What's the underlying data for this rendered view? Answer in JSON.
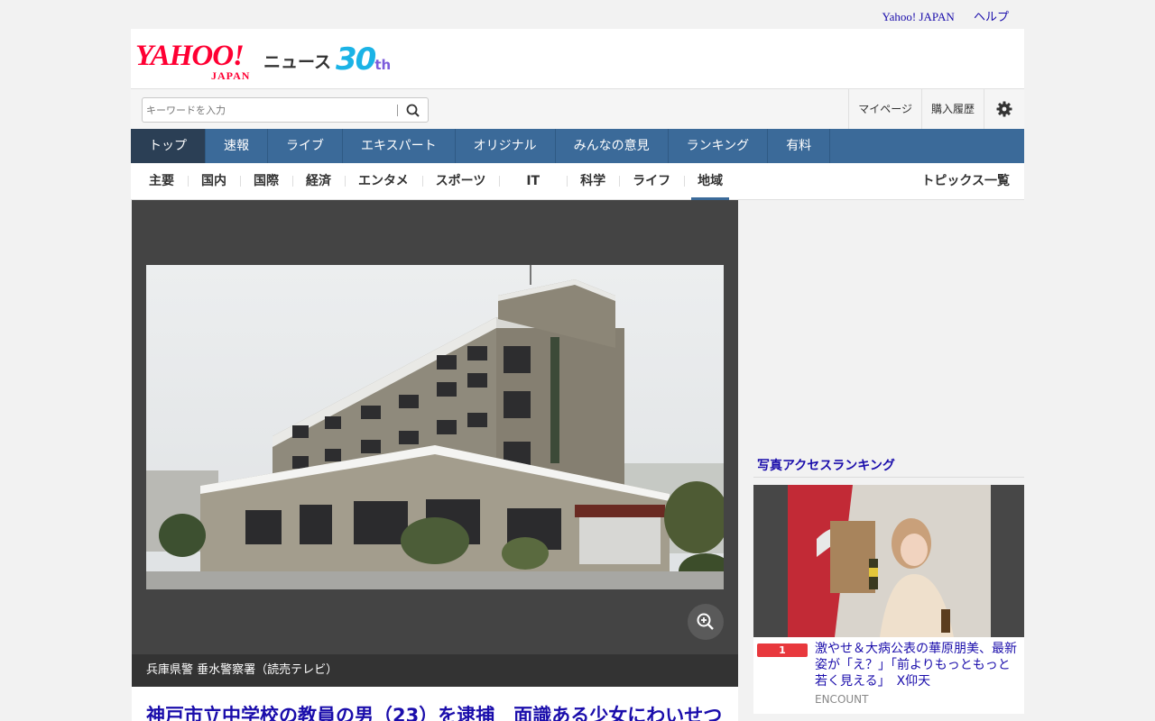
{
  "header": {
    "links": [
      "Yahoo! JAPAN",
      "ヘルプ"
    ],
    "logo": {
      "yahoo": "YAHOO!",
      "japan": "JAPAN",
      "news": "ニュース",
      "anniversary_num": "30",
      "anniversary_suffix": "th"
    }
  },
  "search": {
    "placeholder": "キーワードを入力"
  },
  "account": {
    "mypage": "マイページ",
    "history": "購入履歴"
  },
  "global_nav": [
    "トップ",
    "速報",
    "ライブ",
    "エキスパート",
    "オリジナル",
    "みんなの意見",
    "ランキング",
    "有料"
  ],
  "global_nav_active": "トップ",
  "sub_nav": [
    "主要",
    "国内",
    "国際",
    "経済",
    "エンタメ",
    "スポーツ",
    "IT",
    "科学",
    "ライフ",
    "地域"
  ],
  "sub_nav_active": "地域",
  "topics_link": "トピックス一覧",
  "article": {
    "caption": "兵庫県警 垂水警察署（読売テレビ）",
    "headline": "神戸市立中学校の教員の男（23）を逮捕　面識ある少女にわいせつ"
  },
  "ranking": {
    "title": "写真アクセスランキング",
    "item": {
      "rank": "1",
      "text": "激やせ＆大病公表の華原朋美、最新姿が「え？」「前よりもっともっと若く見える」　X仰天",
      "source": "ENCOUNT"
    }
  },
  "colors": {
    "brand_red": "#ff0033",
    "nav_blue": "#3b6a99",
    "link_blue": "#1a0dab",
    "rank_red": "#e8383d"
  }
}
